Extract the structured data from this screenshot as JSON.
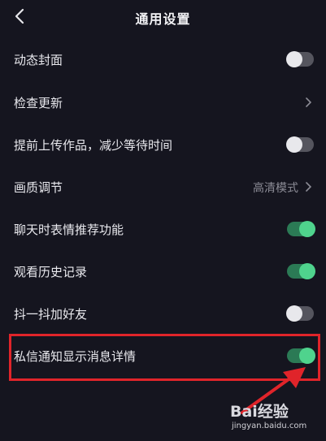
{
  "header": {
    "title": "通用设置",
    "back_icon": "chevron-left-icon"
  },
  "settings": [
    {
      "label": "动态封面",
      "control": "toggle",
      "on": false
    },
    {
      "label": "检查更新",
      "control": "chevron"
    },
    {
      "label": "提前上传作品，减少等待时间",
      "control": "toggle",
      "on": false
    },
    {
      "label": "画质调节",
      "control": "value-chevron",
      "value": "高清模式"
    },
    {
      "label": "聊天时表情推荐功能",
      "control": "toggle",
      "on": true
    },
    {
      "label": "观看历史记录",
      "control": "toggle",
      "on": true
    },
    {
      "label": "抖一抖加好友",
      "control": "toggle",
      "on": false
    },
    {
      "label": "私信通知显示消息详情",
      "control": "toggle",
      "on": true
    }
  ],
  "annotation": {
    "highlight_color": "#e0242a",
    "highlighted_item": "私信通知显示消息详情"
  },
  "watermark": {
    "logo": "Bai经验",
    "url": "jingyan.baidu.com"
  },
  "colors": {
    "background": "#15151f",
    "toggle_on": "#4fd38d",
    "toggle_off": "#55555e"
  }
}
